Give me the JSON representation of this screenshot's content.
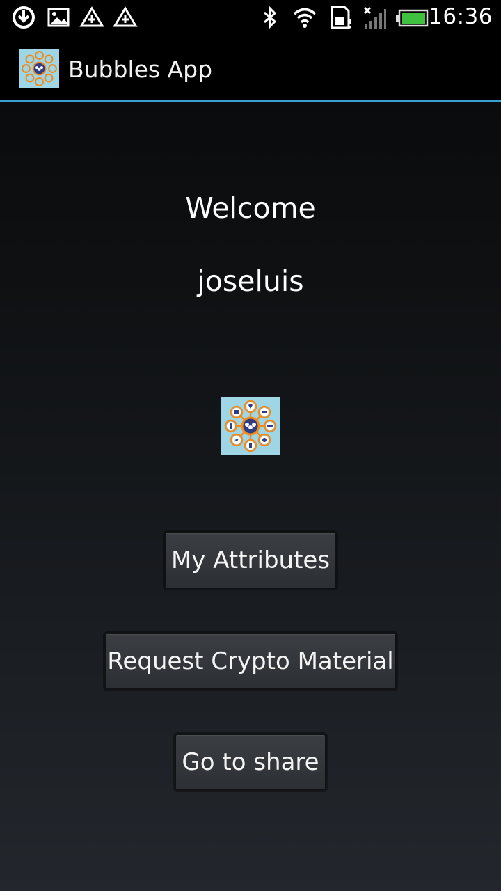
{
  "status_bar": {
    "time": "16:36",
    "icons": [
      "download-icon",
      "image-notification-icon",
      "alert-triangle-icon",
      "alert-triangle-icon",
      "bluetooth-icon",
      "wifi-icon",
      "sd-card-icon",
      "signal-icon",
      "battery-icon"
    ]
  },
  "action_bar": {
    "title": "Bubbles App",
    "icon": "bubbles-app-icon"
  },
  "main": {
    "welcome": "Welcome",
    "username": "joseluis",
    "logo": "bubbles-logo-icon"
  },
  "buttons": {
    "my_attributes": "My Attributes",
    "request_crypto": "Request Crypto Material",
    "go_to_share": "Go to share"
  },
  "colors": {
    "accent": "#3aa0d4",
    "logo_background": "#9fd6e6",
    "logo_ring": "#f08a1c",
    "logo_center": "#2f3d86"
  }
}
